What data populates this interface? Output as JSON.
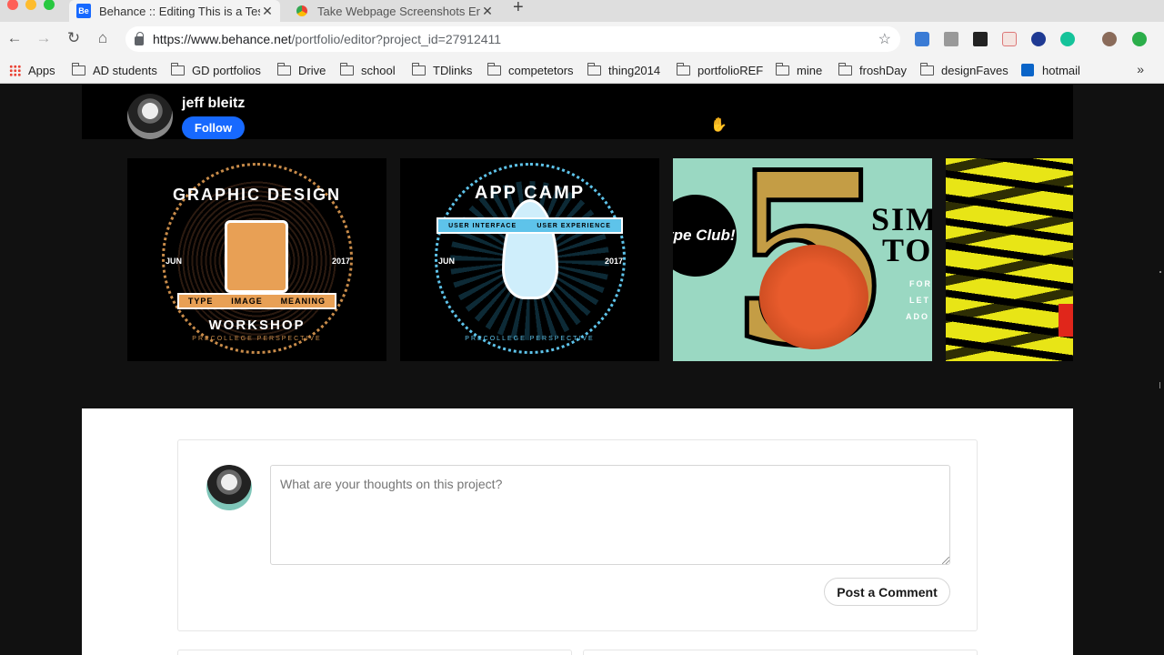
{
  "browser": {
    "tabs": [
      {
        "title": "Behance :: Editing This is a Tes",
        "favicon": "Be",
        "active": true
      },
      {
        "title": "Take Webpage Screenshots En",
        "active": false
      }
    ],
    "new_tab": "+",
    "url_host": "https://www.behance.net",
    "url_path": "/portfolio/editor?project_id=27912411",
    "bookmarks": [
      "Apps",
      "AD students",
      "GD portfolios",
      "Drive",
      "school",
      "TDlinks",
      "competetors",
      "thing2014",
      "portfolioREF",
      "mine",
      "froshDay",
      "designFaves",
      "hotmail"
    ],
    "bookmarks_more": "»"
  },
  "profile": {
    "name": "jeff bleitz",
    "follow_label": "Follow"
  },
  "thumbnails": [
    {
      "title": "GRAPHIC DESIGN",
      "sub": "WORKSHOP",
      "ribbon": [
        "TYPE",
        "IMAGE",
        "MEANING"
      ],
      "side_left": "JUN",
      "side_right": "2017",
      "footer": "PRECOLLEGE PERSPECTIVE",
      "accent": "#e8a055"
    },
    {
      "title": "APP CAMP",
      "ribbon": [
        "USER INTERFACE",
        "USER EXPERIENCE"
      ],
      "side_left": "JUN",
      "side_right": "2017",
      "footer": "PRECOLLEGE PERSPECTIVE",
      "accent": "#5ec3ea"
    },
    {
      "badge": "Type Club!",
      "numeral": "5",
      "heading": [
        "SIM",
        "TO"
      ],
      "small": [
        "FOR",
        "LET",
        "ADO"
      ],
      "bg": "#9ad8c2"
    },
    {
      "bg": "#e8e516"
    }
  ],
  "comment": {
    "placeholder": "What are your thoughts on this project?",
    "post_label": "Post a Comment"
  }
}
